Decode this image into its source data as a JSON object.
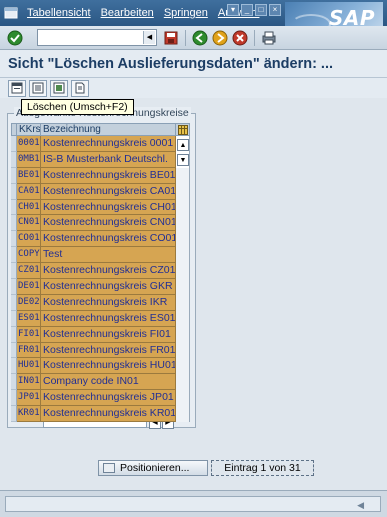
{
  "menu": {
    "items": [
      "Tabellensicht",
      "Bearbeiten",
      "Springen",
      "Auswahl"
    ],
    "logo": "SAP"
  },
  "toolbar": {
    "command_field_value": "",
    "icons": [
      "enter-icon",
      "save-icon",
      "back-icon",
      "exit-icon",
      "cancel-icon",
      "print-icon"
    ]
  },
  "page": {
    "title": "Sicht \"Löschen Auslieferungsdaten\" ändern: ..."
  },
  "app_toolbar": {
    "icons": [
      "new-entries-icon",
      "copy-icon",
      "delete-icon",
      "undo-icon"
    ]
  },
  "tooltip": {
    "text": "Löschen    (Umsch+F2)"
  },
  "group": {
    "title": "Ausgewählte Kostenrechnungskreise"
  },
  "table": {
    "headers": {
      "key": "KKrs",
      "desc": "Bezeichnung"
    },
    "rows": [
      {
        "key": "0001",
        "desc": "Kostenrechnungskreis 0001"
      },
      {
        "key": "0MB1",
        "desc": "IS-B Musterbank Deutschl."
      },
      {
        "key": "BE01",
        "desc": "Kostenrechnungskreis BE01"
      },
      {
        "key": "CA01",
        "desc": "Kostenrechnungskreis CA01"
      },
      {
        "key": "CH01",
        "desc": "Kostenrechnungskreis CH01"
      },
      {
        "key": "CN01",
        "desc": "Kostenrechnungskreis CN01"
      },
      {
        "key": "CO01",
        "desc": "Kostenrechnungskreis CO01"
      },
      {
        "key": "COPY",
        "desc": "Test"
      },
      {
        "key": "CZ01",
        "desc": "Kostenrechnungskreis CZ01"
      },
      {
        "key": "DE01",
        "desc": "Kostenrechnungskreis GKR"
      },
      {
        "key": "DE02",
        "desc": "Kostenrechnungskreis IKR"
      },
      {
        "key": "ES01",
        "desc": "Kostenrechnungskreis ES01"
      },
      {
        "key": "FI01",
        "desc": "Kostenrechnungskreis FI01"
      },
      {
        "key": "FR01",
        "desc": "Kostenrechnungskreis FR01"
      },
      {
        "key": "HU01",
        "desc": "Kostenrechnungskreis HU01"
      },
      {
        "key": "IN01",
        "desc": "Company code  IN01"
      },
      {
        "key": "JP01",
        "desc": "Kostenrechnungskreis JP01"
      },
      {
        "key": "KR01",
        "desc": "Kostenrechnungskreis KR01"
      }
    ]
  },
  "footer": {
    "position_button": "Positionieren...",
    "entry_counter": "Eintrag 1 von 31"
  },
  "colors": {
    "menubar": "#2b5784",
    "row_background": "#d6a552",
    "row_text": "#222f94",
    "title_text": "#1c3d64"
  }
}
